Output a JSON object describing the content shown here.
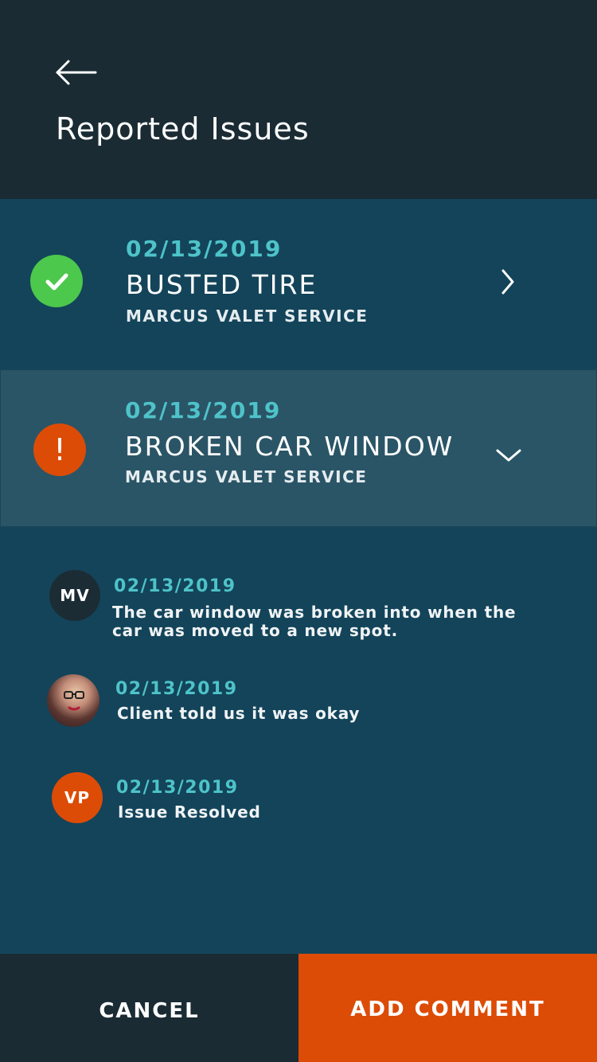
{
  "header": {
    "title": "Reported Issues",
    "back_icon": "arrow-left-icon"
  },
  "issues": [
    {
      "date": "02/13/2019",
      "title": "BUSTED TIRE",
      "subtitle": "MARCUS VALET SERVICE",
      "status": "resolved",
      "status_icon": "check-circle-icon",
      "status_color": "#4cc84c",
      "expand_icon": "chevron-right-icon"
    },
    {
      "date": "02/13/2019",
      "title": "BROKEN CAR WINDOW",
      "subtitle": "MARCUS VALET SERVICE",
      "status": "open",
      "status_icon": "alert-circle-icon",
      "status_symbol": "!",
      "status_color": "#dc4c06",
      "expand_icon": "chevron-down-icon"
    }
  ],
  "comments": [
    {
      "initials": "MV",
      "avatar_color": "#1c2c35",
      "date": "02/13/2019",
      "text": "The car window was broken into when the car was moved to a new spot."
    },
    {
      "initials": "",
      "avatar_type": "photo",
      "date": "02/13/2019",
      "text": "Client told us it was okay"
    },
    {
      "initials": "VP",
      "avatar_color": "#dc4c06",
      "date": "02/13/2019",
      "text": "Issue Resolved"
    }
  ],
  "footer": {
    "cancel_label": "CANCEL",
    "add_comment_label": "ADD COMMENT"
  },
  "colors": {
    "header_bg": "#1a2b34",
    "page_bg": "#13445a",
    "selected_row_bg": "#2a5567",
    "accent_teal": "#4ec3c9",
    "accent_orange": "#dc4c06",
    "success_green": "#4cc84c"
  }
}
